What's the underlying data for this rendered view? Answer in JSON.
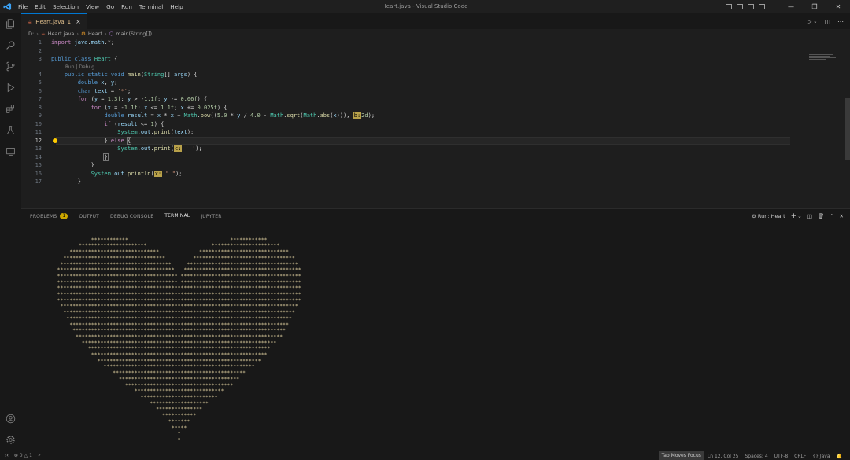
{
  "window": {
    "title": "Heart.java - Visual Studio Code"
  },
  "menu": [
    "File",
    "Edit",
    "Selection",
    "View",
    "Go",
    "Run",
    "Terminal",
    "Help"
  ],
  "tab": {
    "label": "Heart.java",
    "problems": "1",
    "close": "×"
  },
  "breadcrumb": {
    "drive": "D:",
    "file": "Heart.java",
    "class": "Heart",
    "method": "main(String[])"
  },
  "codelens": "Run | Debug",
  "line_numbers": [
    "1",
    "2",
    "3",
    "4",
    "5",
    "6",
    "7",
    "8",
    "9",
    "10",
    "11",
    "12",
    "13",
    "14",
    "15",
    "16",
    "17"
  ],
  "panel": {
    "tabs": [
      "PROBLEMS",
      "OUTPUT",
      "DEBUG CONSOLE",
      "TERMINAL",
      "JUPYTER"
    ],
    "problems_count": "1",
    "run_label": "Run: Heart",
    "add": "+"
  },
  "statusbar": {
    "errors": "0",
    "warnings": "1",
    "tab_focus": "Tab Moves Focus",
    "position": "Ln 12, Col 25",
    "spaces": "Spaces: 4",
    "encoding": "UTF-8",
    "eol": "CRLF",
    "language": "{} Java"
  },
  "colors": {
    "accent": "#0078d4",
    "warning": "#cca700",
    "terminal_text": "#d7c89a"
  }
}
